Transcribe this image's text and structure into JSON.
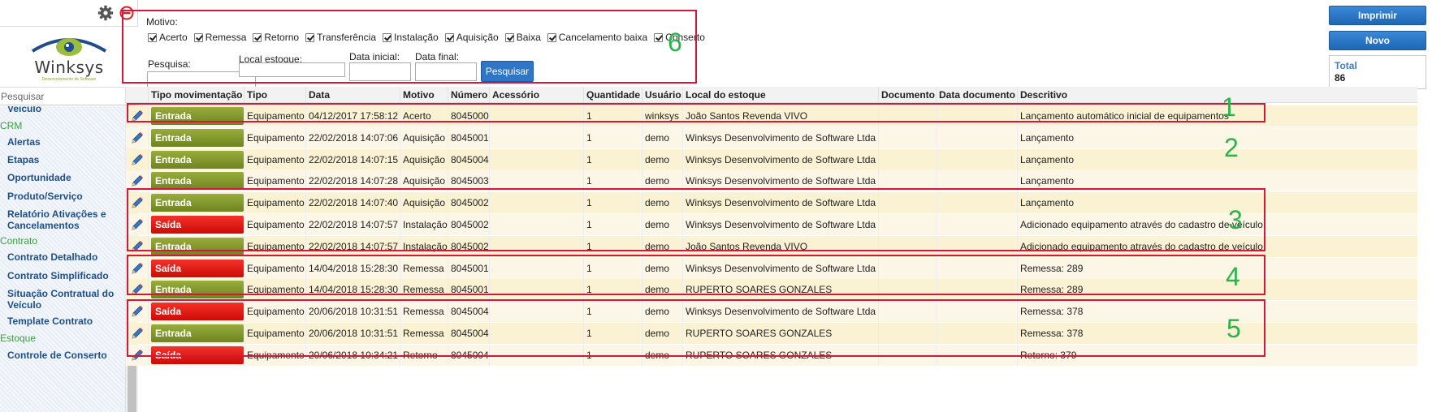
{
  "sidebar": {
    "logo_name": "Winksys",
    "logo_subtitle": "Desenvolvimento de Software",
    "search_placeholder": "Pesquisar",
    "menu": [
      {
        "label": "Veículo",
        "kind": "item"
      },
      {
        "label": "CRM",
        "kind": "section"
      },
      {
        "label": "Alertas",
        "kind": "item"
      },
      {
        "label": "Etapas",
        "kind": "item"
      },
      {
        "label": "Oportunidade",
        "kind": "item"
      },
      {
        "label": "Produto/Serviço",
        "kind": "item"
      },
      {
        "label": "Relatório Ativações e Cancelamentos",
        "kind": "item"
      },
      {
        "label": "Contrato",
        "kind": "section"
      },
      {
        "label": "Contrato Detalhado",
        "kind": "item"
      },
      {
        "label": "Contrato Simplificado",
        "kind": "item"
      },
      {
        "label": "Situação Contratual do Veículo",
        "kind": "item"
      },
      {
        "label": "Template Contrato",
        "kind": "item"
      },
      {
        "label": "Estoque",
        "kind": "section"
      },
      {
        "label": "Controle de Conserto",
        "kind": "item"
      }
    ]
  },
  "filters": {
    "motivo_label": "Motivo:",
    "motivos": [
      {
        "label": "Acerto",
        "checked": true
      },
      {
        "label": "Remessa",
        "checked": true
      },
      {
        "label": "Retorno",
        "checked": true
      },
      {
        "label": "Transferência",
        "checked": true
      },
      {
        "label": "Instalação",
        "checked": true
      },
      {
        "label": "Aquisição",
        "checked": true
      },
      {
        "label": "Baixa",
        "checked": true
      },
      {
        "label": "Cancelamento baixa",
        "checked": true
      },
      {
        "label": "Conserto",
        "checked": true
      }
    ],
    "pesquisa_label": "Pesquisa:",
    "local_estoque_label": "Local estoque:",
    "data_inicial_label": "Data inicial:",
    "data_final_label": "Data final:",
    "pesquisar_button": "Pesquisar"
  },
  "actions": {
    "imprimir": "Imprimir",
    "novo": "Novo",
    "total_label": "Total",
    "total_value": "86"
  },
  "table": {
    "columns": [
      "Tipo movimentação",
      "Tipo",
      "Data",
      "Motivo",
      "Número",
      "Acessório",
      "Quantidade",
      "Usuário",
      "Local do estoque",
      "Documento",
      "Data documento",
      "Descritivo"
    ],
    "rows": [
      {
        "mov": "Entrada",
        "tipo": "Equipamento",
        "data": "04/12/2017 17:58:12",
        "motivo": "Acerto",
        "numero": "8045000",
        "acessorio": "",
        "qtd": "1",
        "usuario": "winksys",
        "local": "João Santos Revenda VIVO",
        "documento": "",
        "data_doc": "",
        "descritivo": "Lançamento automático inicial de equipamentos"
      },
      {
        "mov": "Entrada",
        "tipo": "Equipamento",
        "data": "22/02/2018 14:07:06",
        "motivo": "Aquisição",
        "numero": "8045001",
        "acessorio": "",
        "qtd": "1",
        "usuario": "demo",
        "local": "Winksys Desenvolvimento de Software Ltda",
        "documento": "",
        "data_doc": "",
        "descritivo": "Lançamento"
      },
      {
        "mov": "Entrada",
        "tipo": "Equipamento",
        "data": "22/02/2018 14:07:15",
        "motivo": "Aquisição",
        "numero": "8045004",
        "acessorio": "",
        "qtd": "1",
        "usuario": "demo",
        "local": "Winksys Desenvolvimento de Software Ltda",
        "documento": "",
        "data_doc": "",
        "descritivo": "Lançamento"
      },
      {
        "mov": "Entrada",
        "tipo": "Equipamento",
        "data": "22/02/2018 14:07:28",
        "motivo": "Aquisição",
        "numero": "8045003",
        "acessorio": "",
        "qtd": "1",
        "usuario": "demo",
        "local": "Winksys Desenvolvimento de Software Ltda",
        "documento": "",
        "data_doc": "",
        "descritivo": "Lançamento"
      },
      {
        "mov": "Entrada",
        "tipo": "Equipamento",
        "data": "22/02/2018 14:07:40",
        "motivo": "Aquisição",
        "numero": "8045002",
        "acessorio": "",
        "qtd": "1",
        "usuario": "demo",
        "local": "Winksys Desenvolvimento de Software Ltda",
        "documento": "",
        "data_doc": "",
        "descritivo": "Lançamento"
      },
      {
        "mov": "Saída",
        "tipo": "Equipamento",
        "data": "22/02/2018 14:07:57",
        "motivo": "Instalação",
        "numero": "8045002",
        "acessorio": "",
        "qtd": "1",
        "usuario": "demo",
        "local": "Winksys Desenvolvimento de Software Ltda",
        "documento": "",
        "data_doc": "",
        "descritivo": "Adicionado equipamento através do cadastro de veículo"
      },
      {
        "mov": "Entrada",
        "tipo": "Equipamento",
        "data": "22/02/2018 14:07:57",
        "motivo": "Instalação",
        "numero": "8045002",
        "acessorio": "",
        "qtd": "1",
        "usuario": "demo",
        "local": "João Santos Revenda VIVO",
        "documento": "",
        "data_doc": "",
        "descritivo": "Adicionado equipamento através do cadastro de veículo"
      },
      {
        "mov": "Saída",
        "tipo": "Equipamento",
        "data": "14/04/2018 15:28:30",
        "motivo": "Remessa",
        "numero": "8045001",
        "acessorio": "",
        "qtd": "1",
        "usuario": "demo",
        "local": "Winksys Desenvolvimento de Software Ltda",
        "documento": "",
        "data_doc": "",
        "descritivo": "Remessa: 289"
      },
      {
        "mov": "Entrada",
        "tipo": "Equipamento",
        "data": "14/04/2018 15:28:30",
        "motivo": "Remessa",
        "numero": "8045001",
        "acessorio": "",
        "qtd": "1",
        "usuario": "demo",
        "local": "RUPERTO SOARES GONZALES",
        "documento": "",
        "data_doc": "",
        "descritivo": "Remessa: 289"
      },
      {
        "mov": "Saída",
        "tipo": "Equipamento",
        "data": "20/06/2018 10:31:51",
        "motivo": "Remessa",
        "numero": "8045004",
        "acessorio": "",
        "qtd": "1",
        "usuario": "demo",
        "local": "Winksys Desenvolvimento de Software Ltda",
        "documento": "",
        "data_doc": "",
        "descritivo": "Remessa: 378"
      },
      {
        "mov": "Entrada",
        "tipo": "Equipamento",
        "data": "20/06/2018 10:31:51",
        "motivo": "Remessa",
        "numero": "8045004",
        "acessorio": "",
        "qtd": "1",
        "usuario": "demo",
        "local": "RUPERTO SOARES GONZALES",
        "documento": "",
        "data_doc": "",
        "descritivo": "Remessa: 378"
      },
      {
        "mov": "Saída",
        "tipo": "Equipamento",
        "data": "20/06/2018 10:34:21",
        "motivo": "Retorno",
        "numero": "8045004",
        "acessorio": "",
        "qtd": "1",
        "usuario": "demo",
        "local": "RUPERTO SOARES GONZALES",
        "documento": "",
        "data_doc": "",
        "descritivo": "Retorno: 379"
      }
    ]
  },
  "annotations": [
    "1",
    "2",
    "3",
    "4",
    "5",
    "6"
  ],
  "colors": {
    "entrada": "#7f9428",
    "saida": "#e2140e",
    "primary_button": "#2f77c6",
    "annotation_box": "#d6173b",
    "annotation_number": "#2ab34a",
    "menu_link": "#1f4f87",
    "menu_section": "#39a03c"
  },
  "icons": {
    "settings": "gear-icon",
    "close": "minus-circle-icon",
    "edit": "pencil-icon"
  }
}
